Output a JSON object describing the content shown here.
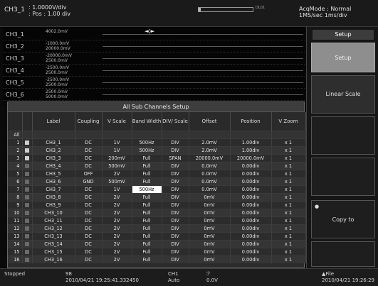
{
  "top": {
    "channel": "CH3_1",
    "vdiv": ": 1.0000V/div",
    "pos": ": Pos : 1.00 div",
    "trigger_label": "DL01",
    "trigger_level": 0.04,
    "acq_mode": "AcqMode : Normal",
    "acq_rate": "1MS/sec  1ms/div"
  },
  "waveform": {
    "rows": [
      {
        "ch": "CH3_1",
        "v1": "4002.0mV",
        "v2": ""
      },
      {
        "ch": "CH3_2",
        "v1": "-1000.0mV",
        "v2": "20000.0mV"
      },
      {
        "ch": "CH3_3",
        "v1": "-20000.0mV",
        "v2": "2500.0mV"
      },
      {
        "ch": "CH3_4",
        "v1": "-2500.0mV",
        "v2": "2500.0mV"
      },
      {
        "ch": "CH3_5",
        "v1": "-2500.0mV",
        "v2": "2500.0mV"
      },
      {
        "ch": "CH3_6",
        "v1": "2500.0mV",
        "v2": "5000.0mV"
      }
    ],
    "cursor": "◄◊►"
  },
  "menu": {
    "title": "Setup",
    "buttons": [
      {
        "label": "Setup"
      },
      {
        "label": "Linear Scale"
      },
      {
        "label": ""
      },
      {
        "label": ""
      },
      {
        "label": "Copy to"
      },
      {
        "label": ""
      }
    ]
  },
  "dialog": {
    "title": "All Sub Channels Setup",
    "headers": [
      "",
      "",
      "Label",
      "Coupling",
      "V Scale",
      "Band Width",
      "DIV/ Scale",
      "Offset",
      "Position",
      "V Zoom"
    ],
    "rows": [
      {
        "n": "All",
        "label": "",
        "coupling": "",
        "vscale": "",
        "bw": "",
        "divs": "",
        "offset": "",
        "position": "",
        "vzoom": ""
      },
      {
        "n": "1",
        "label": "CH3_1",
        "coupling": "DC",
        "vscale": "1V",
        "bw": "500Hz",
        "divs": "DIV",
        "offset": "2.0mV",
        "position": "1.00div",
        "vzoom": "x 1"
      },
      {
        "n": "2",
        "label": "CH3_2",
        "coupling": "DC",
        "vscale": "1V",
        "bw": "500Hz",
        "divs": "DIV",
        "offset": "2.0mV",
        "position": "1.00div",
        "vzoom": "x 1"
      },
      {
        "n": "3",
        "label": "CH3_3",
        "coupling": "DC",
        "vscale": "200mV",
        "bw": "Full",
        "divs": "SPAN",
        "offset": "20000.0mV",
        "position": "20000.0mV",
        "vzoom": "x 1"
      },
      {
        "n": "4",
        "label": "CH3_4",
        "coupling": "DC",
        "vscale": "500mV",
        "bw": "Full",
        "divs": "DIV",
        "offset": "0.0mV",
        "position": "0.00div",
        "vzoom": "x 1"
      },
      {
        "n": "5",
        "label": "CH3_5",
        "coupling": "OFF",
        "vscale": "2V",
        "bw": "Full",
        "divs": "DIV",
        "offset": "0.0mV",
        "position": "0.00div",
        "vzoom": "x 1"
      },
      {
        "n": "6",
        "label": "CH3_6",
        "coupling": "GND",
        "vscale": "500mV",
        "bw": "Full",
        "divs": "DIV",
        "offset": "0.0mV",
        "position": "0.00div",
        "vzoom": "x 1"
      },
      {
        "n": "7",
        "label": "CH3_7",
        "coupling": "DC",
        "vscale": "1V",
        "bw": "500Hz",
        "divs": "DIV",
        "offset": "0.0mV",
        "position": "0.00div",
        "vzoom": "x 1"
      },
      {
        "n": "8",
        "label": "CH3_8",
        "coupling": "DC",
        "vscale": "2V",
        "bw": "Full",
        "divs": "DIV",
        "offset": "0mV",
        "position": "0.00div",
        "vzoom": "x 1"
      },
      {
        "n": "9",
        "label": "CH3_9",
        "coupling": "DC",
        "vscale": "2V",
        "bw": "Full",
        "divs": "DIV",
        "offset": "0mV",
        "position": "0.00div",
        "vzoom": "x 1"
      },
      {
        "n": "10",
        "label": "CH3_10",
        "coupling": "DC",
        "vscale": "2V",
        "bw": "Full",
        "divs": "DIV",
        "offset": "0mV",
        "position": "0.00div",
        "vzoom": "x 1"
      },
      {
        "n": "11",
        "label": "CH3_11",
        "coupling": "DC",
        "vscale": "2V",
        "bw": "Full",
        "divs": "DIV",
        "offset": "0mV",
        "position": "0.00div",
        "vzoom": "x 1"
      },
      {
        "n": "12",
        "label": "CH3_12",
        "coupling": "DC",
        "vscale": "2V",
        "bw": "Full",
        "divs": "DIV",
        "offset": "0mV",
        "position": "0.00div",
        "vzoom": "x 1"
      },
      {
        "n": "13",
        "label": "CH3_13",
        "coupling": "DC",
        "vscale": "2V",
        "bw": "Full",
        "divs": "DIV",
        "offset": "0mV",
        "position": "0.00div",
        "vzoom": "x 1"
      },
      {
        "n": "14",
        "label": "CH3_14",
        "coupling": "DC",
        "vscale": "2V",
        "bw": "Full",
        "divs": "DIV",
        "offset": "0mV",
        "position": "0.00div",
        "vzoom": "x 1"
      },
      {
        "n": "15",
        "label": "CH3_15",
        "coupling": "DC",
        "vscale": "2V",
        "bw": "Full",
        "divs": "DIV",
        "offset": "0mV",
        "position": "0.00div",
        "vzoom": "x 1"
      },
      {
        "n": "16",
        "label": "CH3_16",
        "coupling": "DC",
        "vscale": "2V",
        "bw": "Full",
        "divs": "DIV",
        "offset": "0mV",
        "position": "0.00div",
        "vzoom": "x 1"
      }
    ],
    "selected_row": 7,
    "selected_col": "bw"
  },
  "bottom": {
    "status": "Stopped",
    "count": "98",
    "time": "2010/04/21 19:25:41.332450",
    "ch": "CH1",
    "mode": "Auto",
    "slope": "ℱ",
    "level": "0.0V",
    "file": "File",
    "date": "2010/04/21 19:26:29"
  }
}
